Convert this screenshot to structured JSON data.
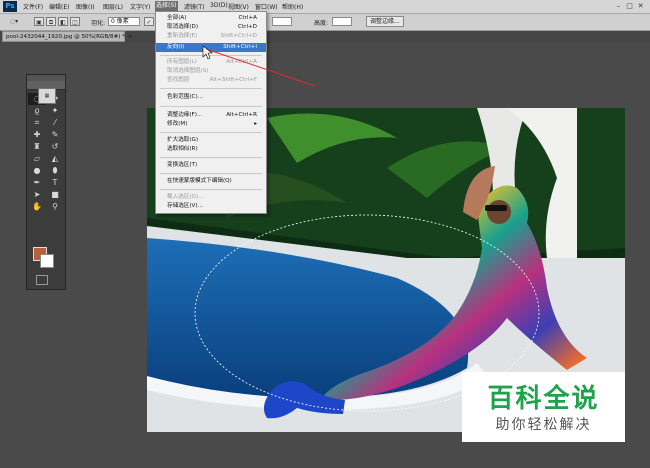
{
  "app": {
    "logo": "Ps"
  },
  "menubar": {
    "items": [
      "文件(F)",
      "编辑(E)",
      "图像(I)",
      "图层(L)",
      "文字(Y)",
      "选择(S)",
      "滤镜(T)",
      "3D(D)",
      "视图(V)",
      "窗口(W)",
      "帮助(H)"
    ],
    "active_index": 5
  },
  "window_controls": {
    "minimize": "–",
    "restore": "□",
    "close": "✕"
  },
  "options": {
    "feather_label": "羽化:",
    "feather_value": "0 像素",
    "antialias_mark": "✓",
    "height_label": "高度:",
    "refine_edge": "调整边缘..."
  },
  "document": {
    "tab_title": "pool-2432044_1920.jpg @ 50%(RGB/8#) *",
    "tab_close": "×"
  },
  "select_menu": {
    "items": [
      {
        "label": "全部(A)",
        "shortcut": "Ctrl+A",
        "disabled": false
      },
      {
        "label": "取消选择(D)",
        "shortcut": "Ctrl+D",
        "disabled": false
      },
      {
        "label": "重新选择(E)",
        "shortcut": "Shift+Ctrl+D",
        "disabled": true
      },
      {
        "label": "反向(I)",
        "shortcut": "Shift+Ctrl+I",
        "disabled": false,
        "highlighted": true
      },
      {
        "label": "所有图层(L)",
        "shortcut": "Alt+Ctrl+A",
        "disabled": true
      },
      {
        "label": "取消选择图层(S)",
        "shortcut": "",
        "disabled": true
      },
      {
        "label": "查找图层",
        "shortcut": "Alt+Shift+Ctrl+F",
        "disabled": true
      },
      {
        "label": "色彩范围(C)...",
        "shortcut": "",
        "disabled": false
      },
      {
        "label": "调整边缘(F)...",
        "shortcut": "Alt+Ctrl+R",
        "disabled": false
      },
      {
        "label": "修改(M)",
        "shortcut": "▸",
        "disabled": false
      },
      {
        "label": "扩大选取(G)",
        "shortcut": "",
        "disabled": false
      },
      {
        "label": "选取相似(R)",
        "shortcut": "",
        "disabled": false
      },
      {
        "label": "变换选区(T)",
        "shortcut": "",
        "disabled": false
      },
      {
        "label": "在快速蒙版模式下编辑(Q)",
        "shortcut": "",
        "disabled": false
      },
      {
        "label": "载入选区(O)...",
        "shortcut": "",
        "disabled": true
      },
      {
        "label": "存储选区(V)...",
        "shortcut": "",
        "disabled": false
      }
    ]
  },
  "watermark": {
    "title": "百科全说",
    "subtitle": "助你轻松解决"
  },
  "colors": {
    "foreground": "#b7603b",
    "background": "#ffffff",
    "accent": "#3b77c9",
    "wm_green": "#1ea34b"
  }
}
